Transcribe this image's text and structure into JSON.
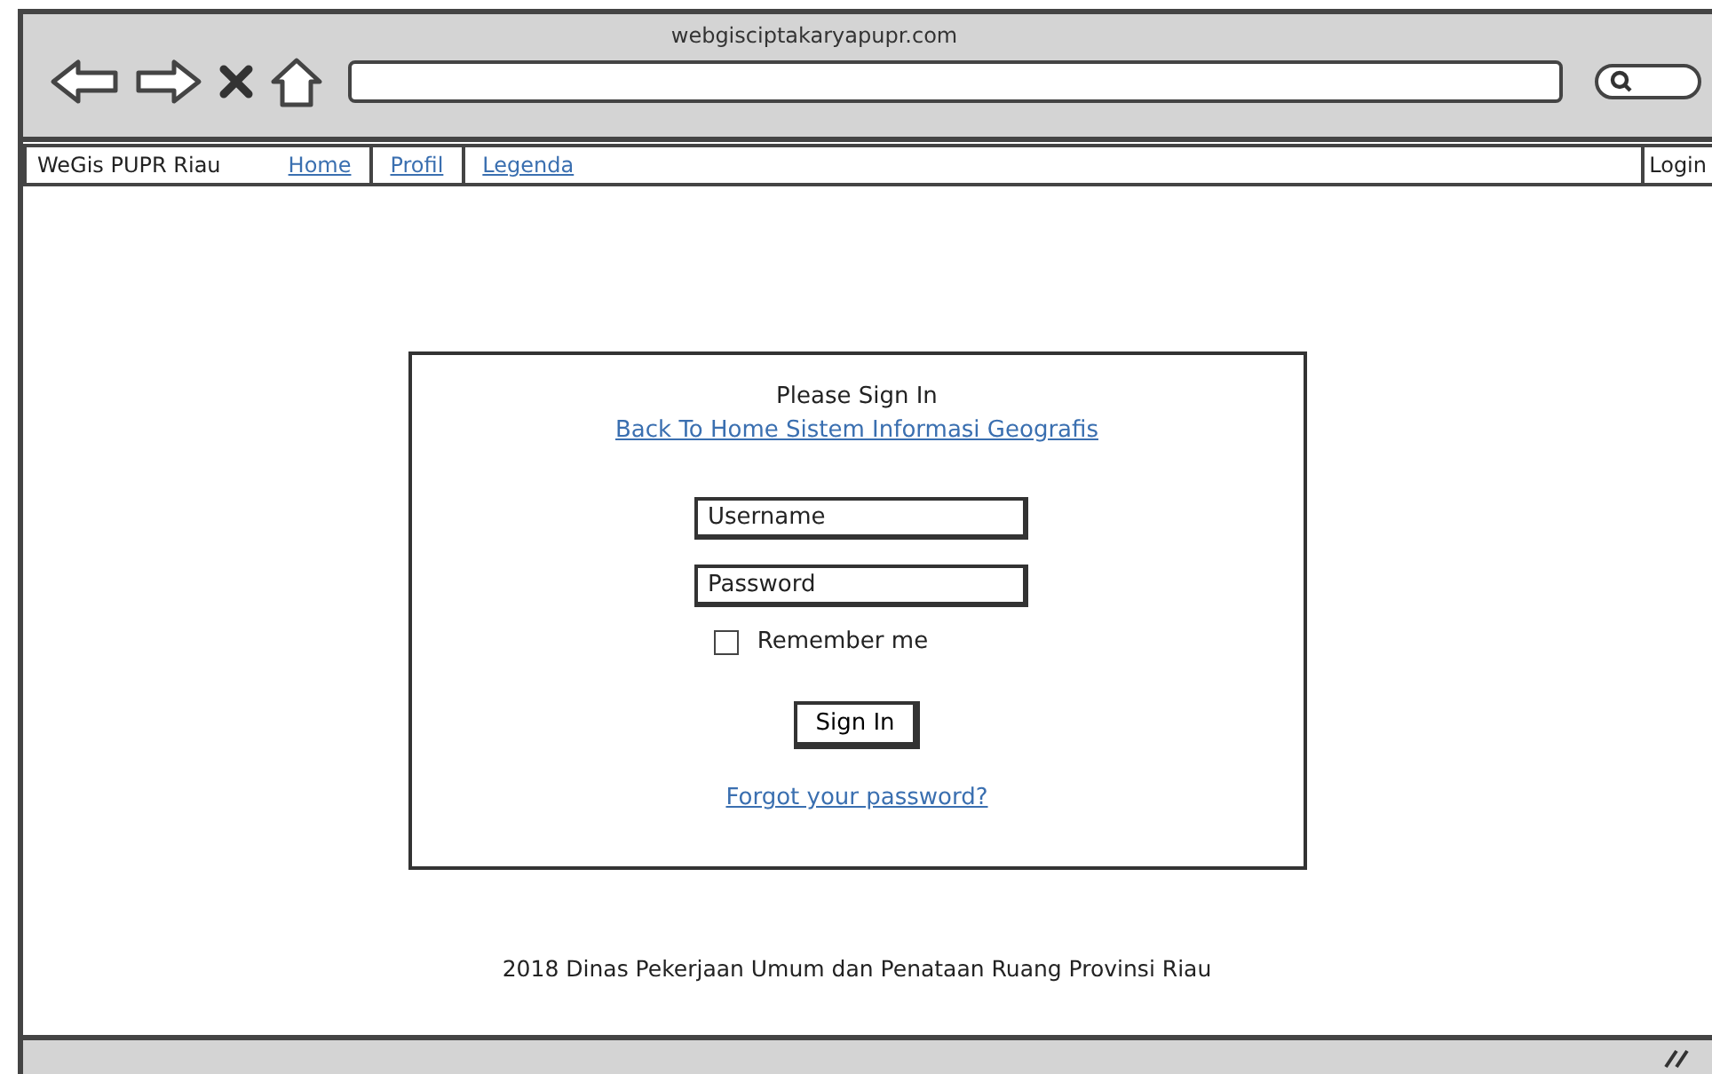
{
  "browser": {
    "url": "webgisciptakaryapupr.com"
  },
  "navbar": {
    "brand": "WeGis PUPR Riau",
    "links": [
      {
        "label": "Home"
      },
      {
        "label": "Profil"
      },
      {
        "label": "Legenda"
      }
    ],
    "login": "Login"
  },
  "login_form": {
    "title": "Please Sign In",
    "back_link": "Back To Home Sistem Informasi Geografis",
    "username": {
      "placeholder": "Username"
    },
    "password": {
      "placeholder": "Password"
    },
    "remember": {
      "label": "Remember me",
      "checked": false
    },
    "submit": "Sign In",
    "forgot_link": "Forgot your password?"
  },
  "footer": "2018 Dinas Pekerjaan Umum dan Penataan Ruang Provinsi Riau"
}
